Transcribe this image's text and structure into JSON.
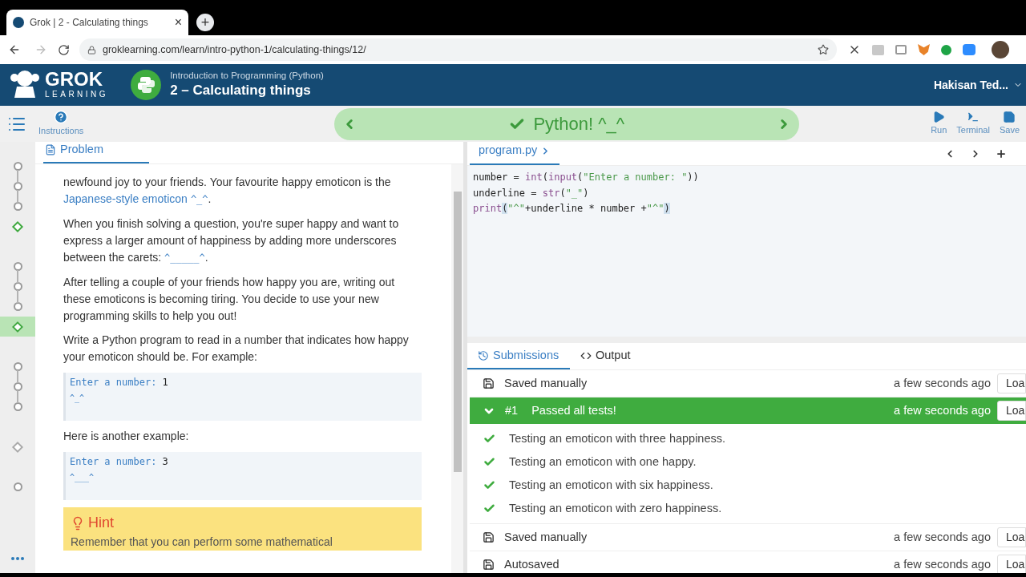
{
  "browser": {
    "tab": {
      "title": "Grok | 2 - Calculating things",
      "close": "×"
    },
    "new_tab": "+",
    "url": "groklearning.com/learn/intro-python-1/calculating-things/12/"
  },
  "header": {
    "logo_title": "GROK",
    "logo_subtitle": "LEARNING",
    "course": "Introduction to Programming (Python)",
    "module": "2 – Calculating things",
    "user": "Hakisan Ted..."
  },
  "toolbar": {
    "instructions": "Instructions",
    "banner": "Python! ^_^",
    "actions": [
      "Run",
      "Terminal",
      "Save"
    ]
  },
  "progress": [
    [
      {
        "kind": "circle",
        "done": false,
        "selected": false
      },
      {
        "kind": "circle",
        "done": false,
        "selected": false
      },
      {
        "kind": "circle",
        "done": false,
        "selected": false
      },
      {
        "kind": "diamond",
        "done": true,
        "selected": false
      }
    ],
    [
      {
        "kind": "circle",
        "done": false,
        "selected": false
      },
      {
        "kind": "circle",
        "done": false,
        "selected": false
      },
      {
        "kind": "circle",
        "done": false,
        "selected": false
      },
      {
        "kind": "diamond",
        "done": true,
        "selected": true
      }
    ],
    [
      {
        "kind": "circle",
        "done": false,
        "selected": false
      },
      {
        "kind": "circle",
        "done": false,
        "selected": false
      },
      {
        "kind": "circle",
        "done": false,
        "selected": false
      }
    ],
    [
      {
        "kind": "diamond",
        "done": false,
        "selected": false
      }
    ],
    [
      {
        "kind": "circle",
        "done": false,
        "selected": false
      }
    ]
  ],
  "problem": {
    "tab": "Problem",
    "blocks": [
      {
        "kind": "paragraph",
        "segments": [
          {
            "kind": "plain",
            "text": "newfound joy to your friends. Your favourite happy emoticon is the "
          },
          {
            "kind": "link",
            "text": "Japanese-style emoticon"
          },
          {
            "kind": "code",
            "text": "^_^"
          },
          {
            "kind": "plain",
            "text": "."
          }
        ]
      },
      {
        "kind": "paragraph",
        "segments": [
          {
            "kind": "plain",
            "text": "When you finish solving a question, you're super happy and want to express a larger amount of happiness by adding more underscores between the carets: "
          },
          {
            "kind": "code",
            "text": "^_____^"
          },
          {
            "kind": "plain",
            "text": "."
          }
        ]
      },
      {
        "kind": "paragraph",
        "segments": [
          {
            "kind": "plain",
            "text": "After telling a couple of your friends how happy you are, writing out these emoticons is becoming tiring. You decide to use your new programming skills to help you out!"
          }
        ]
      },
      {
        "kind": "paragraph",
        "segments": [
          {
            "kind": "plain",
            "text": "Write a Python program to read in a number that indicates how happy your emoticon should be. For example:"
          }
        ]
      },
      {
        "kind": "example",
        "prompt": "Enter a number: ",
        "input": "1",
        "output": "^_^"
      },
      {
        "kind": "paragraph",
        "segments": [
          {
            "kind": "plain",
            "text": "Here is another example:"
          }
        ]
      },
      {
        "kind": "example",
        "prompt": "Enter a number: ",
        "input": "3",
        "output": "^___^"
      },
      {
        "kind": "hint",
        "title": "Hint",
        "text": "Remember that you can perform some mathematical"
      }
    ]
  },
  "editor": {
    "file_tab": "program.py",
    "code": [
      [
        {
          "kind": "plain",
          "text": "number = "
        },
        {
          "kind": "builtin",
          "text": "int"
        },
        {
          "kind": "plain",
          "text": "("
        },
        {
          "kind": "builtin",
          "text": "input"
        },
        {
          "kind": "plain",
          "text": "("
        },
        {
          "kind": "string",
          "text": "\"Enter a number: \""
        },
        {
          "kind": "plain",
          "text": "))"
        }
      ],
      [
        {
          "kind": "plain",
          "text": "underline = "
        },
        {
          "kind": "builtin",
          "text": "str"
        },
        {
          "kind": "plain",
          "text": "("
        },
        {
          "kind": "string",
          "text": "\"_\""
        },
        {
          "kind": "plain",
          "text": ")"
        }
      ],
      [
        {
          "kind": "builtin",
          "text": "print"
        },
        {
          "kind": "match",
          "text": "("
        },
        {
          "kind": "string",
          "text": "\"^\""
        },
        {
          "kind": "plain",
          "text": "+underline * number +"
        },
        {
          "kind": "string",
          "text": "\"^\""
        },
        {
          "kind": "match",
          "text": ")"
        }
      ]
    ]
  },
  "results": {
    "tabs": [
      {
        "label": "Submissions",
        "selected": true
      },
      {
        "label": "Output",
        "selected": false
      }
    ],
    "rows": [
      {
        "kind": "saved",
        "label": "Saved manually",
        "time": "a few seconds ago",
        "button": "Loa"
      },
      {
        "kind": "result",
        "number": "#1",
        "label": "Passed all tests!",
        "time": "a few seconds ago",
        "button": "Loa",
        "expanded": true,
        "tests": [
          "Testing an emoticon with three happiness.",
          "Testing an emoticon with one happy.",
          "Testing an emoticon with six happiness.",
          "Testing an emoticon with zero happiness."
        ]
      },
      {
        "kind": "saved",
        "label": "Saved manually",
        "time": "a few seconds ago",
        "button": "Loa"
      },
      {
        "kind": "saved",
        "label": "Autosaved",
        "time": "a few seconds ago",
        "button": "Loa"
      }
    ]
  }
}
